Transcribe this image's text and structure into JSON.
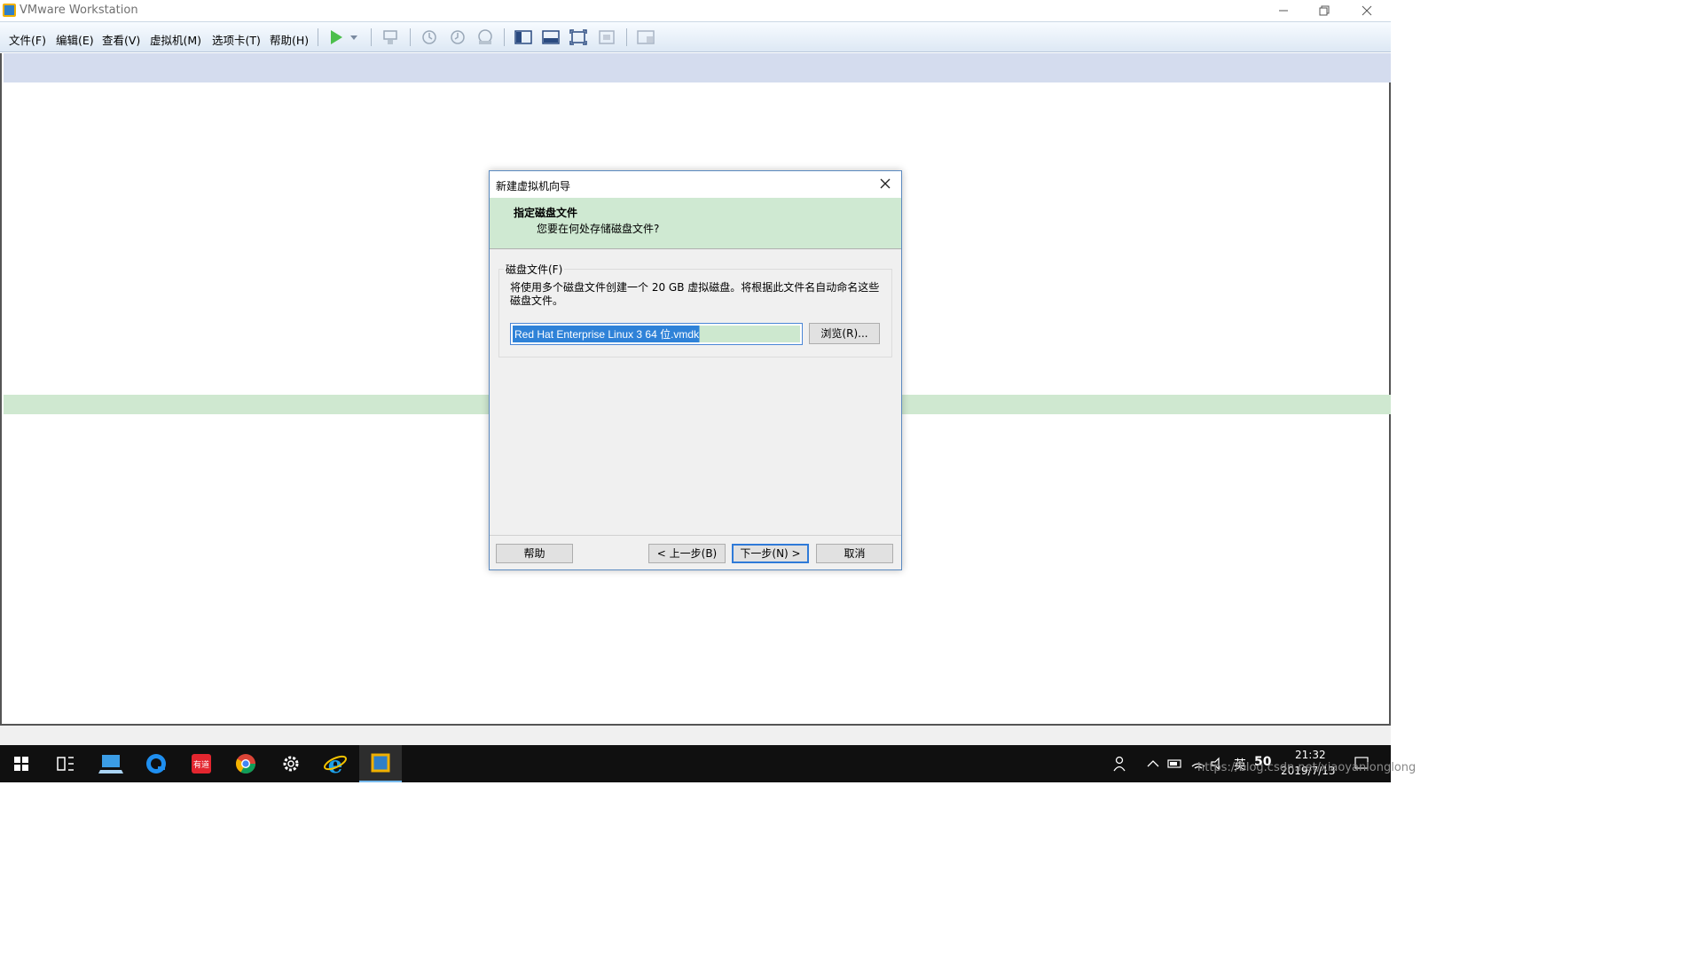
{
  "window": {
    "title": "VMware Workstation"
  },
  "menu": [
    "文件(F)",
    "编辑(E)",
    "查看(V)",
    "虚拟机(M)",
    "选项卡(T)",
    "帮助(H)"
  ],
  "dialog": {
    "title": "新建虚拟机向导",
    "header_title": "指定磁盘文件",
    "header_subtitle": "您要在何处存储磁盘文件?",
    "group_label": "磁盘文件(F)",
    "description": "将使用多个磁盘文件创建一个 20 GB 虚拟磁盘。将根据此文件名自动命名这些磁盘文件。",
    "file_value": "Red Hat Enterprise Linux 3 64 位.vmdk",
    "browse_label": "浏览(R)...",
    "buttons": {
      "help": "帮助",
      "back": "< 上一步(B)",
      "next": "下一步(N) >",
      "cancel": "取消"
    }
  },
  "taskbar": {
    "time": "21:32",
    "date": "2019/7/13",
    "ime": "英",
    "badge": "50",
    "watermark": "https://blog.csdn.net/xiaoyanlonglong"
  },
  "colors": {
    "dialog_header": "#cfe9d2",
    "selection": "#2f82d8",
    "taskbar": "#101010"
  }
}
